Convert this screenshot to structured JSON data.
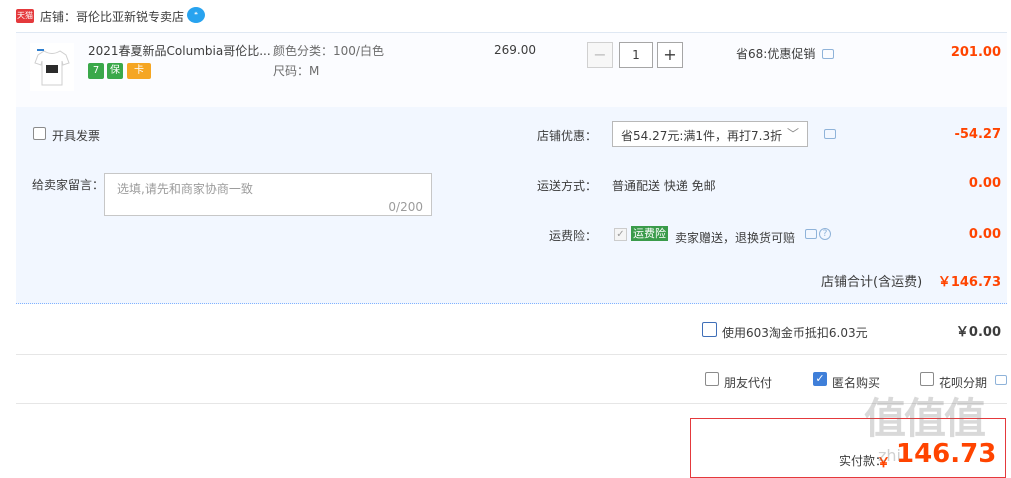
{
  "shop": {
    "logo_text": "天猫",
    "label": "店铺：哥伦比亚新锐专卖店",
    "ww_icon": "wangwang-chat-icon"
  },
  "item": {
    "title": "2021春夏新品Columbia哥伦比...",
    "badges": [
      "7",
      "保",
      "卡"
    ],
    "sku_color": "颜色分类：100/白色",
    "sku_size": "尺码：M",
    "price": "269.00",
    "qty_minus": "−",
    "qty": "1",
    "qty_plus": "+",
    "promo": "省68:优惠促销",
    "subtotal": "201.00"
  },
  "extras": {
    "invoice_label": "开具发票",
    "message_label": "给卖家留言：",
    "message_placeholder": "选填,请先和商家协商一致",
    "message_count": "0/200",
    "shop_discount_label": "店铺优惠：",
    "shop_discount_select": "省54.27元:满1件，再打7.3折",
    "shop_discount_value": "-54.27",
    "shipping_label": "运送方式：",
    "shipping_value": "普通配送 快递 免邮",
    "shipping_cost": "0.00",
    "insurance_label": "运费险：",
    "insurance_tag": "运费险",
    "insurance_text": "卖家赠送，退换货可赔",
    "insurance_cost": "0.00"
  },
  "shop_total": {
    "label": "店铺合计(含运费)",
    "value": "￥146.73"
  },
  "coins": {
    "label": "使用603淘金币抵扣6.03元",
    "value": "￥0.00"
  },
  "options": {
    "friend_pay": "朋友代付",
    "anonymous": "匿名购买",
    "huabei": "花呗分期",
    "anonymous_checked": true
  },
  "pay": {
    "label": "实付款：",
    "currency": "￥",
    "value": "146.73"
  },
  "watermark": {
    "text": "值值值",
    "sub": "zhi"
  },
  "colors": {
    "accent_red": "#ff4400",
    "link_blue": "#3f7fd9",
    "panel_bg": "#f2f7ff"
  }
}
